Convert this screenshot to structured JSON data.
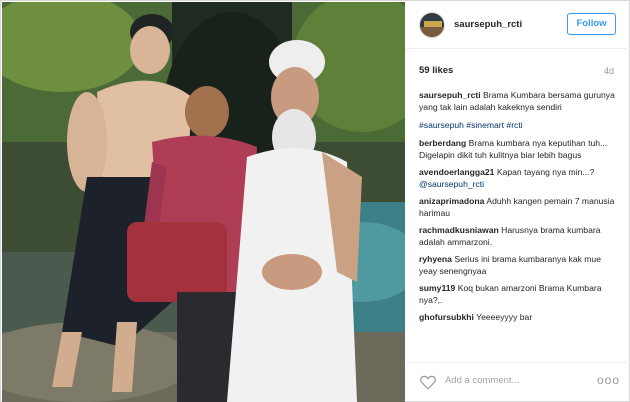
{
  "post": {
    "username": "saursepuh_rcti",
    "follow_label": "Follow",
    "likes": "59 likes",
    "age": "4d",
    "caption": {
      "user": "saursepuh_rcti",
      "text": "Brama Kumbara bersama gurunya yang tak lain adalah kakeknya sendiri"
    },
    "hashtags": "#saursepuh #sinemart #rcti",
    "add_comment_placeholder": "Add a comment...",
    "more_label": "ooo"
  },
  "comments": [
    {
      "user": "berberdang",
      "text": "Brama kumbara nya keputihan tuh... Digelapin dikit tuh kulitnya biar lebih bagus"
    },
    {
      "user": "avendoerlangga21",
      "text": "Kapan tayang nya min...?",
      "mention": "@saursepuh_rcti"
    },
    {
      "user": "anizaprimadona",
      "text": "Aduhh kangen pemain 7 manusia harimau"
    },
    {
      "user": "rachmadkusniawan",
      "text": "Harusnya brama kumbara adalah ammarzoni."
    },
    {
      "user": "ryhyena",
      "text": "Serius ini brama kumbaranya kak mue yeay senengnyaa"
    },
    {
      "user": "sumy119",
      "text": "Koq bukan amarzoni Brama Kumbara nya?,."
    },
    {
      "user": "ghofursubkhi",
      "text": "Yeeeeyyyy bar"
    }
  ],
  "colors": {
    "follow_blue": "#3897f0",
    "hashtag_blue": "#003569",
    "muted_gray": "#999999"
  },
  "icons": {
    "heart": "heart-icon",
    "more": "more-options-icon"
  }
}
